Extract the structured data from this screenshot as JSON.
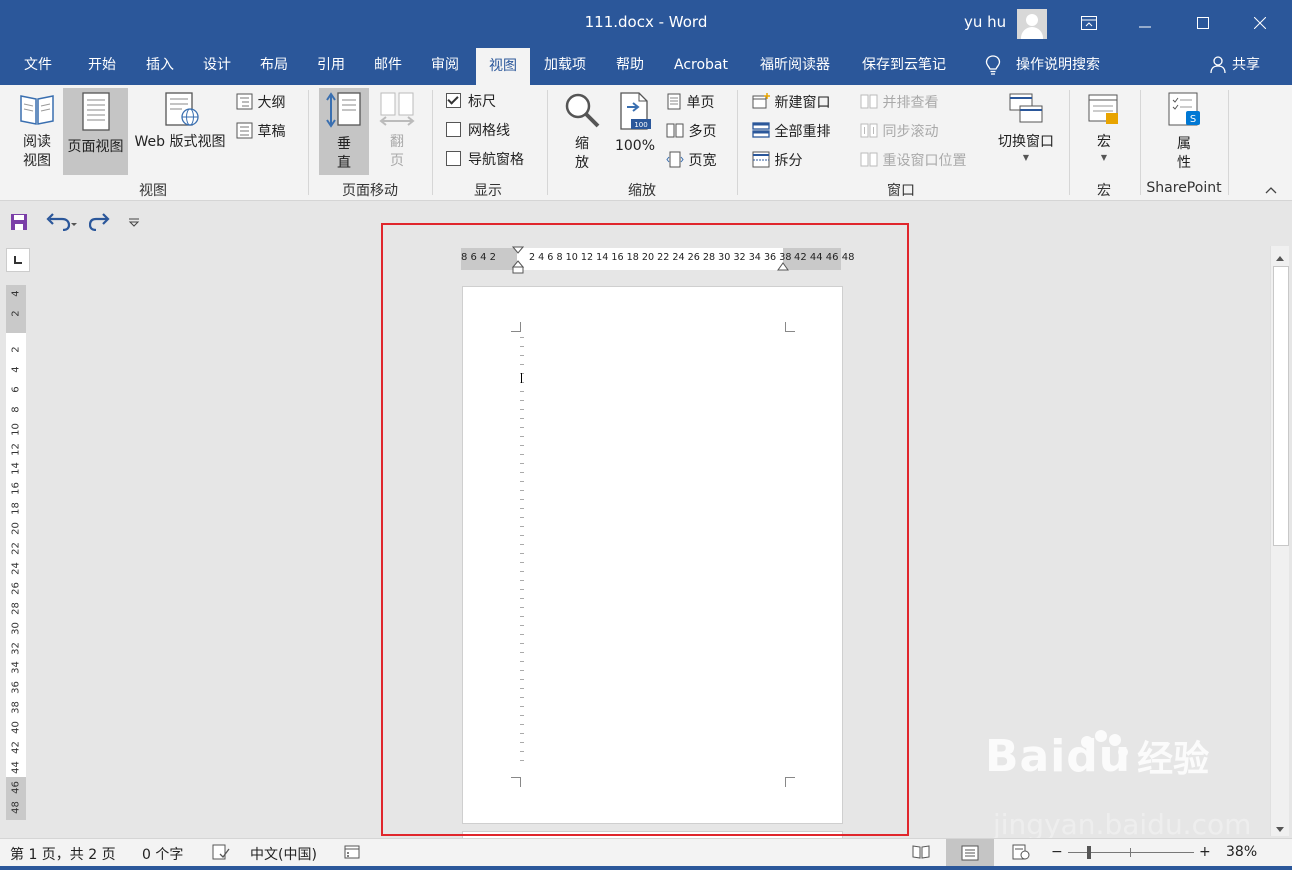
{
  "window": {
    "title": "111.docx  -  Word",
    "user": "yu hu"
  },
  "tabs": [
    "文件",
    "开始",
    "插入",
    "设计",
    "布局",
    "引用",
    "邮件",
    "审阅",
    "视图",
    "加载项",
    "帮助",
    "Acrobat",
    "福昕阅读器",
    "保存到云笔记",
    "操作说明搜索",
    "共享"
  ],
  "ribbon": {
    "views": {
      "read_mode": "阅读\n视图",
      "print_layout": "页面视图",
      "web_layout": "Web 版式视图",
      "outline": "大纲",
      "draft": "草稿",
      "group": "视图"
    },
    "page_movement": {
      "vertical": "垂\n直",
      "side_to_side": "翻\n页",
      "group": "页面移动"
    },
    "show": {
      "ruler": "标尺",
      "ruler_checked": true,
      "gridlines": "网格线",
      "gridlines_checked": false,
      "navigation_pane": "导航窗格",
      "navigation_pane_checked": false,
      "group": "显示"
    },
    "zoom": {
      "zoom": "缩\n放",
      "percent": "100%",
      "icon_badge": "100",
      "one_page": "单页",
      "multiple_pages": "多页",
      "page_width": "页宽",
      "group": "缩放"
    },
    "window": {
      "new_window": "新建窗口",
      "arrange_all": "全部重排",
      "split": "拆分",
      "side_by_side": "并排查看",
      "sync_scroll": "同步滚动",
      "reset_position": "重设窗口位置",
      "switch_windows": "切换窗口",
      "group": "窗口"
    },
    "macros": {
      "macros": "宏",
      "group": "宏"
    },
    "sharepoint": {
      "properties": "属\n性",
      "group": "SharePoint"
    }
  },
  "ruler": {
    "h_left": "8  6  4  2",
    "h_main": "2  4  6  8 10 12 14 16 18 20 22 24 26 28 30 32 34 36 38",
    "h_right": "42 44 46 48",
    "v_top": [
      "4",
      "2"
    ],
    "v_main": [
      "2",
      "4",
      "6",
      "8",
      "10",
      "12",
      "14",
      "16",
      "18",
      "20",
      "22",
      "24",
      "26",
      "28",
      "30",
      "32",
      "34",
      "36",
      "38",
      "40",
      "42",
      "44"
    ],
    "v_bottom": [
      "46",
      "48"
    ]
  },
  "status": {
    "page": "第 1 页，共 2 页",
    "words": "0 个字",
    "language": "中文(中国)",
    "zoom": "38%",
    "zoom_level": 0.38
  },
  "watermark": {
    "brand": "Baidu",
    "cn": "经验",
    "url": "jingyan.baidu.com"
  },
  "colors": {
    "accent": "#2b579a",
    "highlight_box": "#e0262c"
  }
}
